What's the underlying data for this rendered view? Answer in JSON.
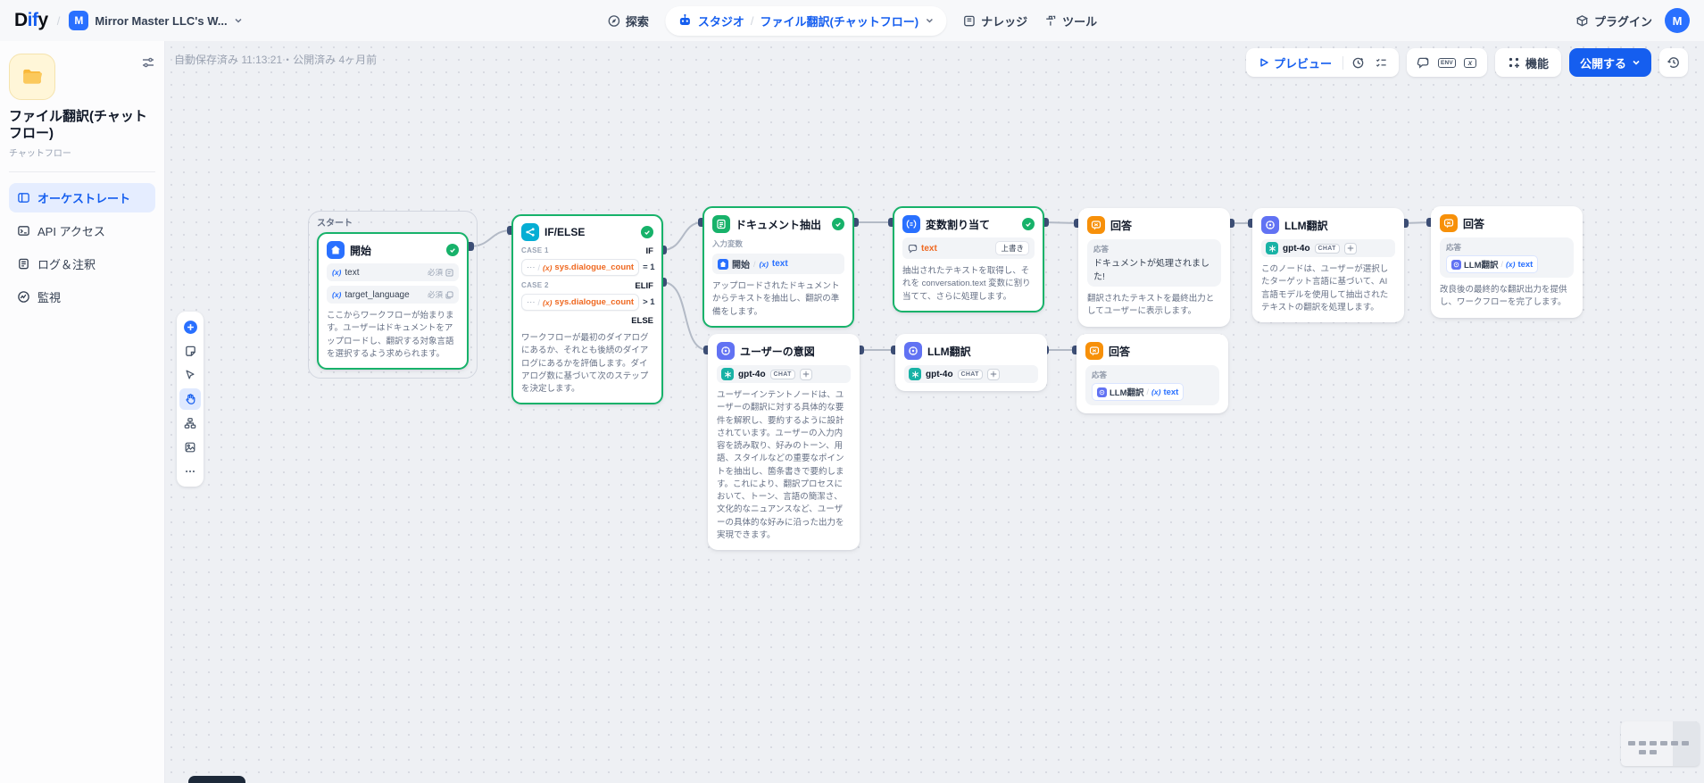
{
  "misc": {
    "slash": "/",
    "dots": "···"
  },
  "icons": {
    "var_glyph": "(x)",
    "env_label": "ENV",
    "x_label": "x"
  },
  "header": {
    "logo_d": "D",
    "logo_if": "if",
    "logo_y": "y",
    "workspace_initial": "M",
    "workspace_name": "Mirror Master LLC's W...",
    "explore": "探索",
    "studio": "スタジオ",
    "app_breadcrumb": "ファイル翻訳(チャットフロー)",
    "knowledge": "ナレッジ",
    "tools": "ツール",
    "plugins": "プラグイン",
    "avatar_initial": "M"
  },
  "sidebar": {
    "app_title": "ファイル翻訳(チャットフロー)",
    "app_type": "チャットフロー",
    "items": [
      {
        "label": "オーケストレート"
      },
      {
        "label": "API アクセス"
      },
      {
        "label": "ログ＆注釈"
      },
      {
        "label": "監視"
      }
    ]
  },
  "toolbar": {
    "autosave": "自動保存済み 11:13:21・公開済み 4ヶ月前",
    "preview": "プレビュー",
    "features": "機能",
    "publish": "公開する"
  },
  "nodes": {
    "start": {
      "group_label": "スタート",
      "title": "開始",
      "fields": [
        {
          "name": "text",
          "required": "必須"
        },
        {
          "name": "target_language",
          "required": "必須"
        }
      ],
      "desc": "ここからワークフローが始まります。ユーザーはドキュメントをアップロードし、翻訳する対象言語を選択するよう求められます。"
    },
    "ifelse": {
      "title": "IF/ELSE",
      "case1_label": "CASE 1",
      "case1_kw": "IF",
      "case1_var": "sys.dialogue_count",
      "case1_op": "= 1",
      "case2_label": "CASE 2",
      "case2_kw": "ELIF",
      "case2_var": "sys.dialogue_count",
      "case2_op": "> 1",
      "else_kw": "ELSE",
      "desc": "ワークフローが最初のダイアログにあるか、それとも後続のダイアログにあるかを評価します。ダイアログ数に基づいて次のステップを決定します。"
    },
    "doc_extract": {
      "title": "ドキュメント抽出",
      "input_label": "入力変数",
      "source": "開始",
      "var": "text",
      "desc": "アップロードされたドキュメントからテキストを抽出し、翻訳の準備をします。"
    },
    "var_assign": {
      "title": "変数割り当て",
      "var": "text",
      "mode_badge": "上書き",
      "desc": "抽出されたテキストを取得し、それを conversation.text 変数に割り当てて、さらに処理します。"
    },
    "answer_doc": {
      "title": "回答",
      "reply_label": "応答",
      "reply_text": "ドキュメントが処理されました!",
      "desc": "翻訳されたテキストを最終出力としてユーザーに表示します。"
    },
    "llm_translate": {
      "title": "LLM翻訳",
      "model": "gpt-4o",
      "model_badge": "CHAT",
      "desc": "このノードは、ユーザーが選択したターゲット言語に基づいて、AI 言語モデルを使用して抽出されたテキストの翻訳を処理します。"
    },
    "answer_final": {
      "title": "回答",
      "reply_label": "応答",
      "source": "LLM翻訳",
      "var": "text",
      "desc": "改良後の最終的な翻訳出力を提供し、ワークフローを完了します。"
    },
    "user_intent": {
      "title": "ユーザーの意図",
      "model": "gpt-4o",
      "model_badge": "CHAT",
      "desc": "ユーザーインテントノードは、ユーザーの翻訳に対する具体的な要件を解釈し、要約するように設計されています。ユーザーの入力内容を読み取り、好みのトーン、用語、スタイルなどの重要なポイントを抽出し、箇条書きで要約します。これにより、翻訳プロセスにおいて、トーン、言語の簡潔さ、文化的なニュアンスなど、ユーザーの具体的な好みに沿った出力を実現できます。"
    },
    "llm_refine": {
      "title": "LLM翻訳",
      "model": "gpt-4o",
      "model_badge": "CHAT"
    },
    "answer_refined": {
      "title": "回答",
      "reply_label": "応答",
      "source": "LLM翻訳",
      "var": "text"
    }
  },
  "colors": {
    "accent": "#155eef",
    "success": "#17b26a",
    "answer": "#f79009",
    "llm": "#6172f3",
    "ifelse": "#06aed4",
    "node_blue": "#2970ff",
    "sys_var": "#ef6820"
  }
}
